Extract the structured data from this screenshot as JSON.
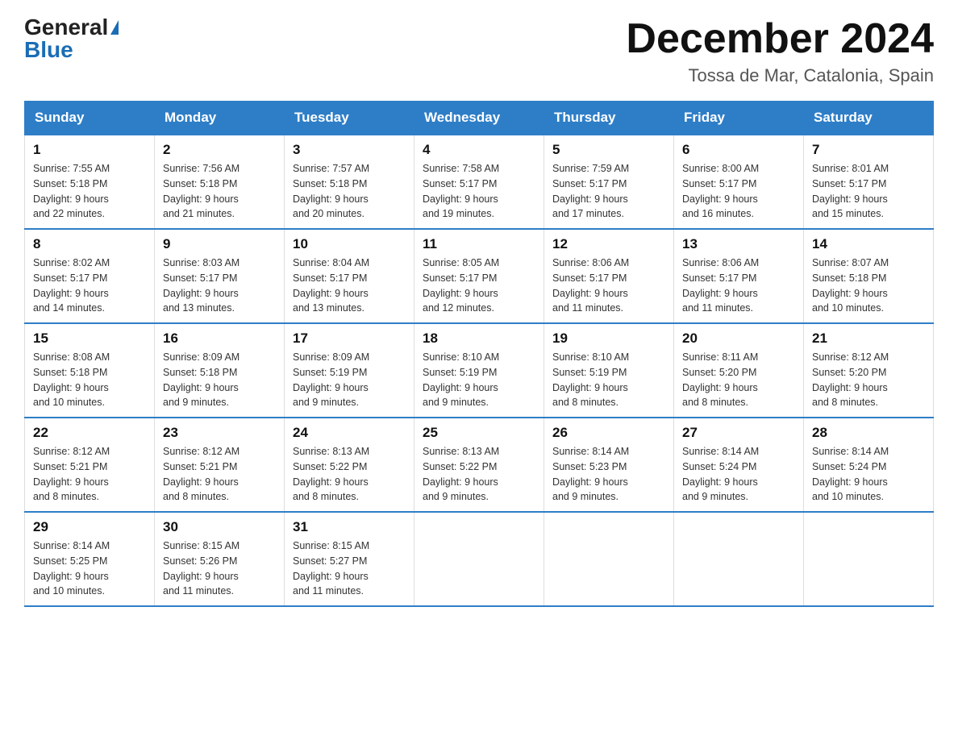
{
  "header": {
    "logo_general": "General",
    "logo_blue": "Blue",
    "month_title": "December 2024",
    "subtitle": "Tossa de Mar, Catalonia, Spain"
  },
  "weekdays": [
    "Sunday",
    "Monday",
    "Tuesday",
    "Wednesday",
    "Thursday",
    "Friday",
    "Saturday"
  ],
  "weeks": [
    [
      {
        "day": 1,
        "sunrise": "7:55 AM",
        "sunset": "5:18 PM",
        "daylight": "9 hours and 22 minutes."
      },
      {
        "day": 2,
        "sunrise": "7:56 AM",
        "sunset": "5:18 PM",
        "daylight": "9 hours and 21 minutes."
      },
      {
        "day": 3,
        "sunrise": "7:57 AM",
        "sunset": "5:18 PM",
        "daylight": "9 hours and 20 minutes."
      },
      {
        "day": 4,
        "sunrise": "7:58 AM",
        "sunset": "5:17 PM",
        "daylight": "9 hours and 19 minutes."
      },
      {
        "day": 5,
        "sunrise": "7:59 AM",
        "sunset": "5:17 PM",
        "daylight": "9 hours and 17 minutes."
      },
      {
        "day": 6,
        "sunrise": "8:00 AM",
        "sunset": "5:17 PM",
        "daylight": "9 hours and 16 minutes."
      },
      {
        "day": 7,
        "sunrise": "8:01 AM",
        "sunset": "5:17 PM",
        "daylight": "9 hours and 15 minutes."
      }
    ],
    [
      {
        "day": 8,
        "sunrise": "8:02 AM",
        "sunset": "5:17 PM",
        "daylight": "9 hours and 14 minutes."
      },
      {
        "day": 9,
        "sunrise": "8:03 AM",
        "sunset": "5:17 PM",
        "daylight": "9 hours and 13 minutes."
      },
      {
        "day": 10,
        "sunrise": "8:04 AM",
        "sunset": "5:17 PM",
        "daylight": "9 hours and 13 minutes."
      },
      {
        "day": 11,
        "sunrise": "8:05 AM",
        "sunset": "5:17 PM",
        "daylight": "9 hours and 12 minutes."
      },
      {
        "day": 12,
        "sunrise": "8:06 AM",
        "sunset": "5:17 PM",
        "daylight": "9 hours and 11 minutes."
      },
      {
        "day": 13,
        "sunrise": "8:06 AM",
        "sunset": "5:17 PM",
        "daylight": "9 hours and 11 minutes."
      },
      {
        "day": 14,
        "sunrise": "8:07 AM",
        "sunset": "5:18 PM",
        "daylight": "9 hours and 10 minutes."
      }
    ],
    [
      {
        "day": 15,
        "sunrise": "8:08 AM",
        "sunset": "5:18 PM",
        "daylight": "9 hours and 10 minutes."
      },
      {
        "day": 16,
        "sunrise": "8:09 AM",
        "sunset": "5:18 PM",
        "daylight": "9 hours and 9 minutes."
      },
      {
        "day": 17,
        "sunrise": "8:09 AM",
        "sunset": "5:19 PM",
        "daylight": "9 hours and 9 minutes."
      },
      {
        "day": 18,
        "sunrise": "8:10 AM",
        "sunset": "5:19 PM",
        "daylight": "9 hours and 9 minutes."
      },
      {
        "day": 19,
        "sunrise": "8:10 AM",
        "sunset": "5:19 PM",
        "daylight": "9 hours and 8 minutes."
      },
      {
        "day": 20,
        "sunrise": "8:11 AM",
        "sunset": "5:20 PM",
        "daylight": "9 hours and 8 minutes."
      },
      {
        "day": 21,
        "sunrise": "8:12 AM",
        "sunset": "5:20 PM",
        "daylight": "9 hours and 8 minutes."
      }
    ],
    [
      {
        "day": 22,
        "sunrise": "8:12 AM",
        "sunset": "5:21 PM",
        "daylight": "9 hours and 8 minutes."
      },
      {
        "day": 23,
        "sunrise": "8:12 AM",
        "sunset": "5:21 PM",
        "daylight": "9 hours and 8 minutes."
      },
      {
        "day": 24,
        "sunrise": "8:13 AM",
        "sunset": "5:22 PM",
        "daylight": "9 hours and 8 minutes."
      },
      {
        "day": 25,
        "sunrise": "8:13 AM",
        "sunset": "5:22 PM",
        "daylight": "9 hours and 9 minutes."
      },
      {
        "day": 26,
        "sunrise": "8:14 AM",
        "sunset": "5:23 PM",
        "daylight": "9 hours and 9 minutes."
      },
      {
        "day": 27,
        "sunrise": "8:14 AM",
        "sunset": "5:24 PM",
        "daylight": "9 hours and 9 minutes."
      },
      {
        "day": 28,
        "sunrise": "8:14 AM",
        "sunset": "5:24 PM",
        "daylight": "9 hours and 10 minutes."
      }
    ],
    [
      {
        "day": 29,
        "sunrise": "8:14 AM",
        "sunset": "5:25 PM",
        "daylight": "9 hours and 10 minutes."
      },
      {
        "day": 30,
        "sunrise": "8:15 AM",
        "sunset": "5:26 PM",
        "daylight": "9 hours and 11 minutes."
      },
      {
        "day": 31,
        "sunrise": "8:15 AM",
        "sunset": "5:27 PM",
        "daylight": "9 hours and 11 minutes."
      },
      null,
      null,
      null,
      null
    ]
  ]
}
